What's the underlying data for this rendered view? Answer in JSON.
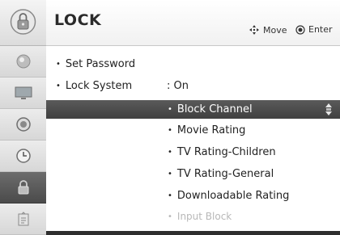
{
  "header": {
    "title": "LOCK",
    "hints": [
      {
        "icon": "dpad-move-icon",
        "label": "Move"
      },
      {
        "icon": "enter-button-icon",
        "label": "Enter"
      }
    ]
  },
  "sidebar": {
    "items": [
      {
        "icon": "picture-icon"
      },
      {
        "icon": "screen-icon"
      },
      {
        "icon": "audio-icon"
      },
      {
        "icon": "clock-icon"
      },
      {
        "icon": "lock-icon",
        "active": true
      },
      {
        "icon": "options-icon"
      }
    ]
  },
  "menu": {
    "items": [
      {
        "label": "Set Password"
      },
      {
        "label": "Lock System",
        "value": ": On"
      }
    ],
    "sub_items": [
      {
        "label": "Block Channel",
        "selected": true
      },
      {
        "label": "Movie Rating"
      },
      {
        "label": "TV Rating-Children"
      },
      {
        "label": "TV Rating-General"
      },
      {
        "label": "Downloadable Rating"
      },
      {
        "label": "Input Block",
        "disabled": true
      }
    ]
  },
  "colors": {
    "highlight": "#4a4a4a",
    "content_bg": "#ffffff",
    "sidebar_active": "#555555"
  }
}
